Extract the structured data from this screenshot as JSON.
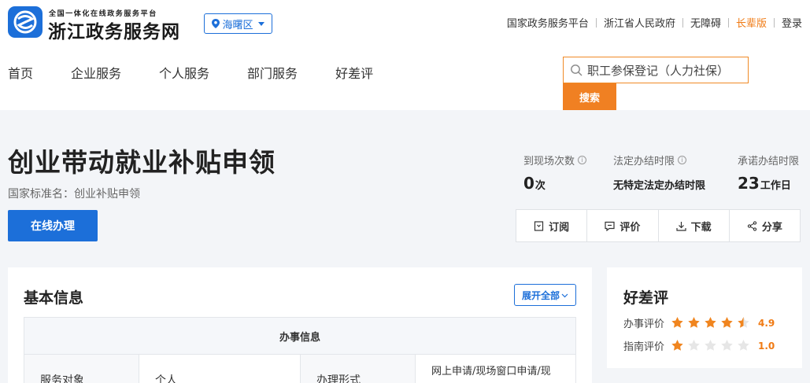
{
  "header": {
    "logo_small": "全国一体化在线政务服务平台",
    "logo_big": "浙江政务服务网",
    "region": "海曙区",
    "top_links": [
      {
        "label": "国家政务服务平台"
      },
      {
        "label": "浙江省人民政府"
      },
      {
        "label": "无障碍"
      },
      {
        "label": "长辈版"
      },
      {
        "label": "登录"
      }
    ],
    "nav": [
      "首页",
      "企业服务",
      "个人服务",
      "部门服务",
      "好差评"
    ],
    "search_text": "职工参保登记（人力社保）",
    "search_button": "搜索",
    "colors": {
      "brand_blue": "#1c6fd9",
      "accent_orange": "#f08022"
    }
  },
  "item": {
    "title": "创业带动就业补贴申领",
    "standard_name": "国家标准名：创业补贴申领",
    "online_button": "在线办理",
    "stats": {
      "visits_label": "到现场次数",
      "visits_value": "0",
      "visits_unit": "次",
      "legal_label": "法定办结时限",
      "legal_value": "无特定法定办结时限",
      "promise_label": "承诺办结时限",
      "promise_value": "23",
      "promise_unit": "工作日"
    },
    "actions": [
      "订阅",
      "评价",
      "下载",
      "分享"
    ]
  },
  "basic_info": {
    "title": "基本信息",
    "expand_button": "展开全部",
    "table_header": "办事信息",
    "row": {
      "k1": "服务对象",
      "v1": "个人",
      "k2": "办理形式",
      "v2": "网上申请/现场窗口申请/现"
    }
  },
  "rating": {
    "title": "好差评",
    "rows": [
      {
        "label": "办事评价",
        "score": "4.9",
        "stars": 4.5
      },
      {
        "label": "指南评价",
        "score": "1.0",
        "stars": 1
      }
    ]
  }
}
